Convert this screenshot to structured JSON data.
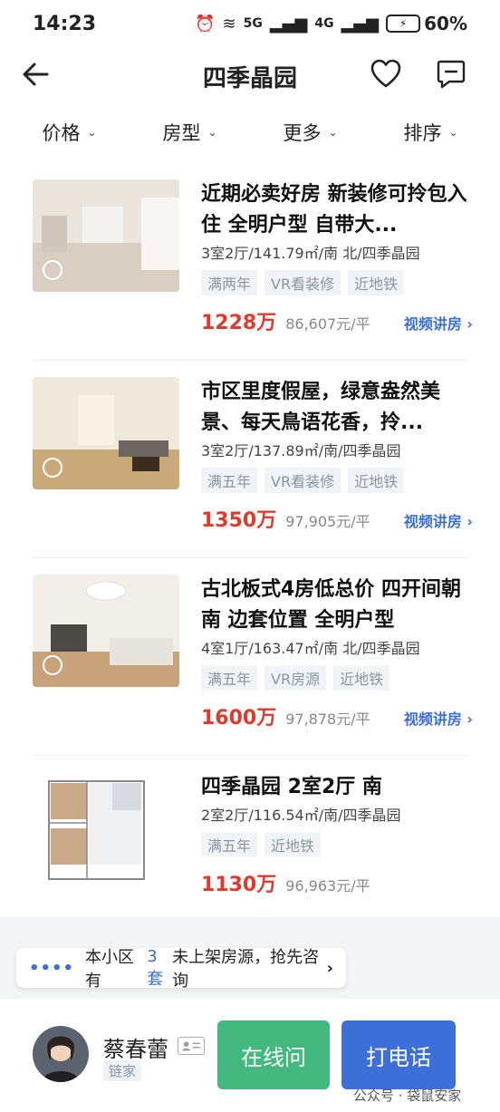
{
  "status": {
    "time": "14:23",
    "network_5g": "5G",
    "network_4g": "4G",
    "battery": "60%"
  },
  "header": {
    "title": "四季晶园"
  },
  "filters": [
    {
      "label": "价格"
    },
    {
      "label": "房型"
    },
    {
      "label": "更多"
    },
    {
      "label": "排序"
    }
  ],
  "listings": [
    {
      "title": "近期必卖好房 新装修可拎包入住 全明户型 自带大...",
      "meta": "3室2厅/141.79㎡/南 北/四季晶园",
      "tags": [
        "满两年",
        "VR看装修",
        "近地铁"
      ],
      "price": "1228万",
      "unit_price": "86,607元/平",
      "video": "视频讲房 ›"
    },
    {
      "title": "市区里度假屋，绿意盎然美景、每天鳥语花香，拎...",
      "meta": "3室2厅/137.89㎡/南/四季晶园",
      "tags": [
        "满五年",
        "VR看装修",
        "近地铁"
      ],
      "price": "1350万",
      "unit_price": "97,905元/平",
      "video": "视频讲房 ›"
    },
    {
      "title": "古北板式4房低总价 四开间朝南 边套位置 全明户型",
      "meta": "4室1厅/163.47㎡/南 北/四季晶园",
      "tags": [
        "满五年",
        "VR房源",
        "近地铁"
      ],
      "price": "1600万",
      "unit_price": "97,878元/平",
      "video": "视频讲房 ›"
    },
    {
      "title": "四季晶园 2室2厅 南",
      "meta": "2室2厅/116.54㎡/南/四季晶园",
      "tags": [
        "满五年",
        "近地铁"
      ],
      "price": "1130万",
      "unit_price": "96,963元/平",
      "video": ""
    }
  ],
  "consult": {
    "dots": "••••",
    "prefix": "本小区有",
    "count": "3套",
    "suffix": "未上架房源，抢先咨询",
    "arrow": "›"
  },
  "agent": {
    "name": "蔡春蕾",
    "company": "链家"
  },
  "actions": {
    "online": "在线问",
    "call": "打电话"
  },
  "watermark": "公众号 · 袋鼠安家"
}
